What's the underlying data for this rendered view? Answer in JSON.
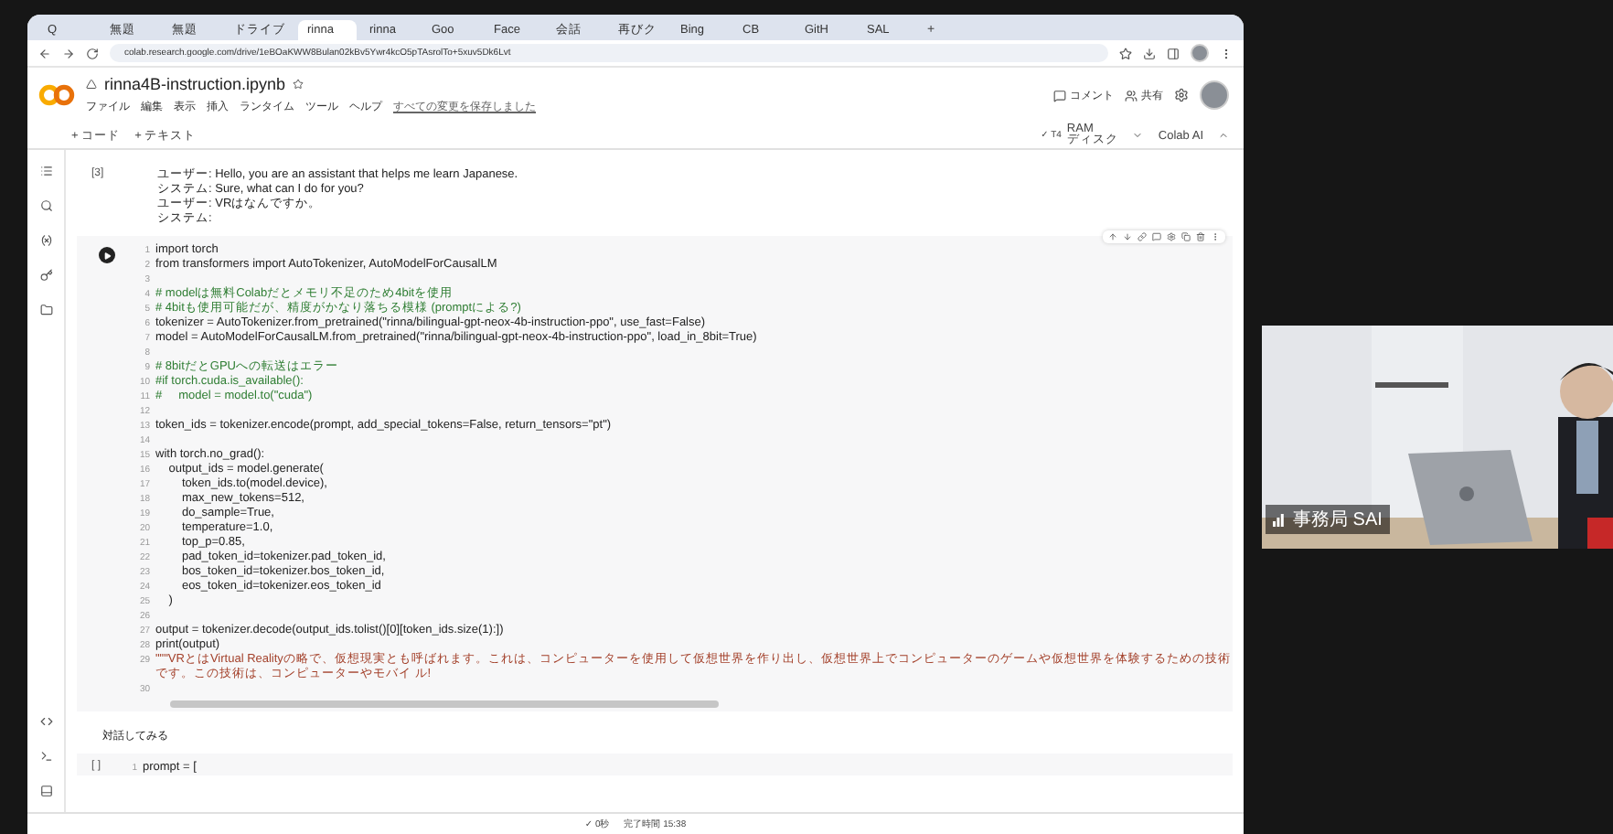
{
  "browser": {
    "tabs": [
      {
        "label": "Q",
        "selected": false
      },
      {
        "label": "無題",
        "selected": false
      },
      {
        "label": "無題",
        "selected": false
      },
      {
        "label": "ドライブ",
        "selected": false
      },
      {
        "label": "rinna",
        "selected": true
      },
      {
        "label": "rinna",
        "selected": false
      },
      {
        "label": "Goo",
        "selected": false
      },
      {
        "label": "Face",
        "selected": false
      },
      {
        "label": "会話",
        "selected": false
      },
      {
        "label": "再びク",
        "selected": false
      },
      {
        "label": "Bing",
        "selected": false
      },
      {
        "label": "CB",
        "selected": false
      },
      {
        "label": "GitH",
        "selected": false
      },
      {
        "label": "SAL",
        "selected": false
      }
    ],
    "new_tab": "+",
    "url": "colab.research.google.com/drive/1eBOaKWW8Bulan02kBv5Ywr4kcO5pTAsrolTo+5xuv5Dk6Lvt"
  },
  "notebook": {
    "title": "rinna4B-instruction.ipynb",
    "menu": [
      "ファイル",
      "編集",
      "表示",
      "挿入",
      "ランタイム",
      "ツール",
      "ヘルプ"
    ],
    "save_status": "すべての変更を保存しました",
    "comment": "コメント",
    "share": "共有",
    "toolbar": [
      "+ コード",
      "+ テキスト"
    ],
    "runtime": {
      "gpu": "✓ T4",
      "ram": "RAM",
      "disk": "ディスク"
    },
    "ai_button": "Colab AI"
  },
  "cells": [
    {
      "kind": "output",
      "prompt": "[3]",
      "lines": [
        "ユーザー: Hello, you are an assistant that helps me learn Japanese.",
        "システム: Sure, what can I do for you?",
        "ユーザー: VRはなんですか。",
        "システム:"
      ]
    },
    {
      "kind": "code",
      "lines": [
        {
          "n": "1",
          "text": "import torch",
          "kind": "code"
        },
        {
          "n": "2",
          "text": "from transformers import AutoTokenizer, AutoModelForCausalLM",
          "kind": "code"
        },
        {
          "n": "3"
        },
        {
          "n": "4",
          "text": "# modelは無料Colabだとメモリ不足のため4bitを使用",
          "kind": "comment"
        },
        {
          "n": "5",
          "text": "# 4bitも使用可能だが、精度がかなり落ちる模様 (promptによる?)",
          "kind": "comment"
        },
        {
          "n": "6",
          "text": "tokenizer = AutoTokenizer.from_pretrained(\"rinna/bilingual-gpt-neox-4b-instruction-ppo\", use_fast=False)",
          "kind": "code"
        },
        {
          "n": "7",
          "text": "model = AutoModelForCausalLM.from_pretrained(\"rinna/bilingual-gpt-neox-4b-instruction-ppo\", load_in_8bit=True)",
          "kind": "code"
        },
        {
          "n": "8"
        },
        {
          "n": "9",
          "text": "# 8bitだとGPUへの転送はエラー",
          "kind": "comment"
        },
        {
          "n": "10",
          "text": "#if torch.cuda.is_available():",
          "kind": "comment"
        },
        {
          "n": "11",
          "text": "#     model = model.to(\"cuda\")",
          "kind": "comment"
        },
        {
          "n": "12"
        },
        {
          "n": "13",
          "text": "token_ids = tokenizer.encode(prompt, add_special_tokens=False, return_tensors=\"pt\")",
          "kind": "code"
        },
        {
          "n": "14"
        },
        {
          "n": "15",
          "text": "with torch.no_grad():",
          "kind": "code"
        },
        {
          "n": "16",
          "text": "    output_ids = model.generate(",
          "kind": "code"
        },
        {
          "n": "17",
          "text": "        token_ids.to(model.device),",
          "kind": "code"
        },
        {
          "n": "18",
          "text": "        max_new_tokens=512,",
          "kind": "code"
        },
        {
          "n": "19",
          "text": "        do_sample=True,",
          "kind": "code"
        },
        {
          "n": "20",
          "text": "        temperature=1.0,",
          "kind": "code"
        },
        {
          "n": "21",
          "text": "        top_p=0.85,",
          "kind": "code"
        },
        {
          "n": "22",
          "text": "        pad_token_id=tokenizer.pad_token_id,",
          "kind": "code"
        },
        {
          "n": "23",
          "text": "        bos_token_id=tokenizer.bos_token_id,",
          "kind": "code"
        },
        {
          "n": "24",
          "text": "        eos_token_id=tokenizer.eos_token_id",
          "kind": "code"
        },
        {
          "n": "25",
          "text": "    )",
          "kind": "code"
        },
        {
          "n": "26"
        },
        {
          "n": "27",
          "text": "output = tokenizer.decode(output_ids.tolist()[0][token_ids.size(1):])",
          "kind": "code"
        },
        {
          "n": "28",
          "text": "print(output)",
          "kind": "code"
        },
        {
          "n": "29",
          "text": "\"\"\"VRとはVirtual Realityの略で、仮想現実とも呼ばれます。これは、コンピューターを使用して仮想世界を作り出し、仮想世界上でコンピューターのゲームや仮想世界を体験するための技術です。この技術は、コンピューターやモバイ ル!",
          "kind": "string"
        },
        {
          "n": "30"
        }
      ]
    },
    {
      "kind": "text",
      "text": "対話してみる"
    },
    {
      "kind": "code",
      "prompt": "[ ]",
      "lines": [
        {
          "n": "1",
          "text": "prompt = [",
          "kind": "code"
        }
      ]
    }
  ],
  "status_bar": {
    "duration": "✓ 0秒",
    "completed": "完了時間 15:38"
  },
  "video": {
    "name": "事務局 SAI"
  }
}
